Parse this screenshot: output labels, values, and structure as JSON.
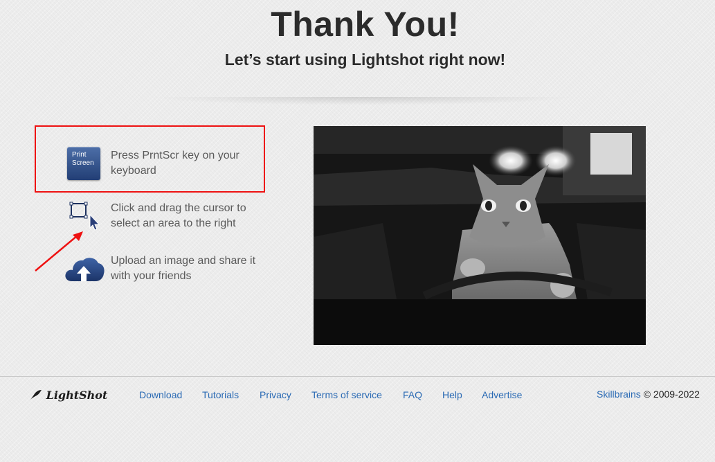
{
  "header": {
    "title": "Thank You!",
    "subtitle": "Let’s start using Lightshot right now!"
  },
  "steps": [
    {
      "icon": "print-screen-key-icon",
      "key_label_1": "Print",
      "key_label_2": "Screen",
      "text_1": "Press PrntScr key on your",
      "text_2": "keyboard"
    },
    {
      "icon": "selection-cursor-icon",
      "text_1": "Click and drag the cursor to",
      "text_2": "select an area to the right"
    },
    {
      "icon": "cloud-upload-icon",
      "text_1": "Upload an image and share it",
      "text_2": "with your friends"
    }
  ],
  "annotation": {
    "highlight_color": "#ee1111",
    "arrow_color": "#ee1111"
  },
  "footer": {
    "logo": "LightShot",
    "nav": [
      "Download",
      "Tutorials",
      "Privacy",
      "Terms of service",
      "FAQ",
      "Help",
      "Advertise"
    ],
    "company": "Skillbrains",
    "copyright": "© 2009-2022"
  },
  "colors": {
    "link": "#2a6ab4",
    "heading": "#2b2b2b",
    "body_text": "#5a5a5a"
  }
}
